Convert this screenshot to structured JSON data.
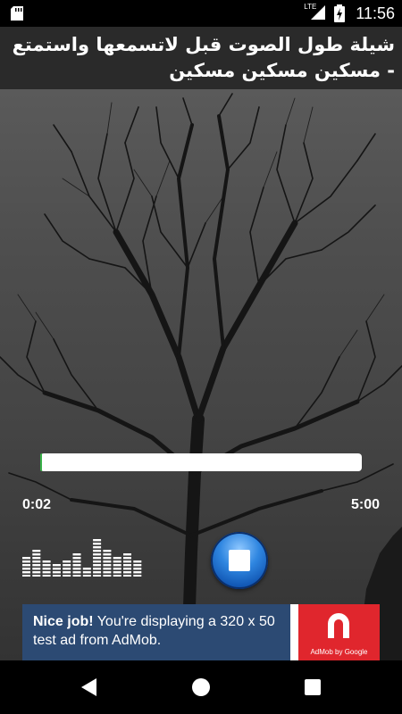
{
  "status_bar": {
    "network": "LTE",
    "time": "11:56"
  },
  "title_bar": {
    "title": "شيلة طول الصوت قبل لاتسمعها واستمتع - مسكين مسكين مسكين"
  },
  "player": {
    "progress_fraction": 0.0067,
    "elapsed": "0:02",
    "total": "5:00",
    "progress_color": "#3ab24a",
    "button_color": "#1a6fd1"
  },
  "ad": {
    "headline": "Nice job!",
    "body": " You're displaying a 320 x 50 test ad from AdMob.",
    "brand": "AdMob by Google",
    "logo_color": "#e0262d"
  },
  "icons": {
    "sd_card": "sd-card-icon",
    "signal": "cell-signal-icon",
    "battery": "battery-charging-icon",
    "back": "back-triangle-icon",
    "home": "home-circle-icon",
    "recents": "recents-square-icon",
    "stop": "stop-icon",
    "equalizer": "equalizer-icon"
  }
}
